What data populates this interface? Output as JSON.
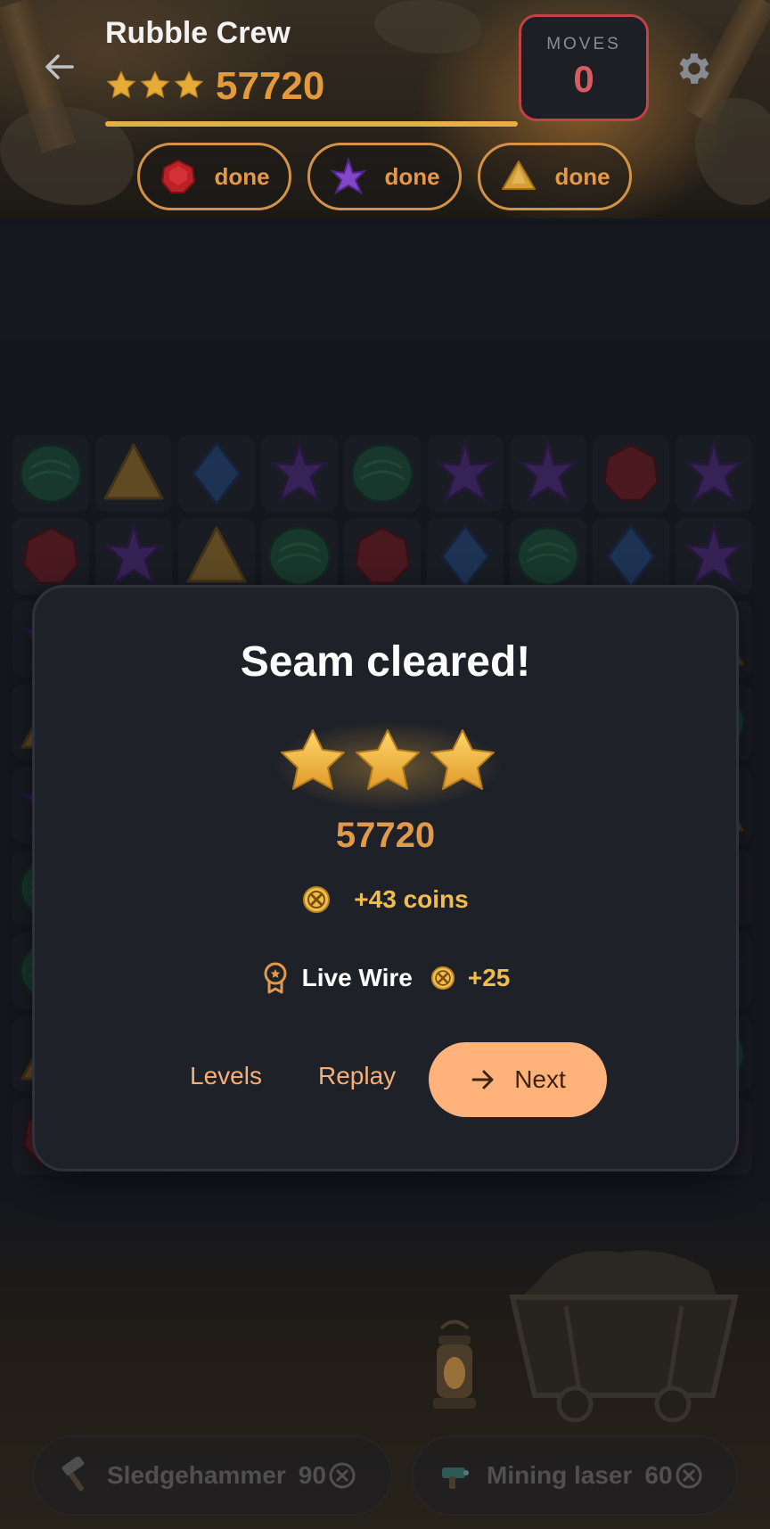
{
  "header": {
    "level_name": "Rubble Crew",
    "score": "57720",
    "stars_earned": 3,
    "moves_label": "MOVES",
    "moves_value": "0"
  },
  "goals": [
    {
      "gem": "red-gem-icon",
      "status": "done"
    },
    {
      "gem": "purple-crystal-icon",
      "status": "done"
    },
    {
      "gem": "gold-nugget-icon",
      "status": "done"
    }
  ],
  "modal": {
    "title": "Seam cleared!",
    "stars": 3,
    "score": "57720",
    "coins_text": "+43 coins",
    "achievement_name": "Live Wire",
    "achievement_bonus": "+25",
    "levels_label": "Levels",
    "replay_label": "Replay",
    "next_label": "Next"
  },
  "boosters": [
    {
      "label": "Sledgehammer",
      "cost": "90"
    },
    {
      "label": "Mining laser",
      "cost": "60"
    }
  ],
  "colors": {
    "accent": "#e09a4b",
    "gold": "#f2be4b",
    "moves_red": "#e06468",
    "next_button": "#ffb27a",
    "panel": "#1f2129"
  }
}
